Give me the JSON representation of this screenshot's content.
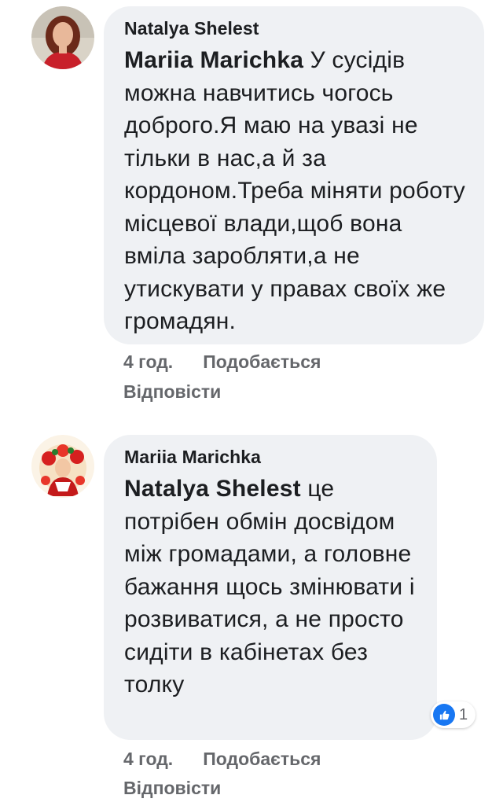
{
  "comments": [
    {
      "author": "Natalya Shelest",
      "mention": "Mariia Marichka",
      "text": " У сусідів можна навчитись чогось доброго.Я маю на увазі не тільки в нас,а й за кордоном.Треба міняти роботу місцевої влади,щоб вона вміла заробляти,а не утискувати у правах своїх же громадян.",
      "time": "4 год.",
      "like_label": "Подобається",
      "reply_label": "Відповісти",
      "avatar_icon": "user-avatar-photo"
    },
    {
      "author": "Mariia Marichka",
      "mention": "Natalya Shelest",
      "text": " це потрібен обмін досвідом між громадами, а головне бажання щось змінювати і розвиватися, а не просто сидіти в кабінетах без толку",
      "time": "4 год.",
      "like_label": "Подобається",
      "reply_label": "Відповісти",
      "avatar_icon": "user-avatar-illustration",
      "reaction_count": "1",
      "reaction_icon": "like-icon"
    }
  ],
  "colors": {
    "bubble": "#eff1f4",
    "text": "#1c1e21",
    "meta": "#65676b",
    "like_blue": "#1877f2"
  }
}
